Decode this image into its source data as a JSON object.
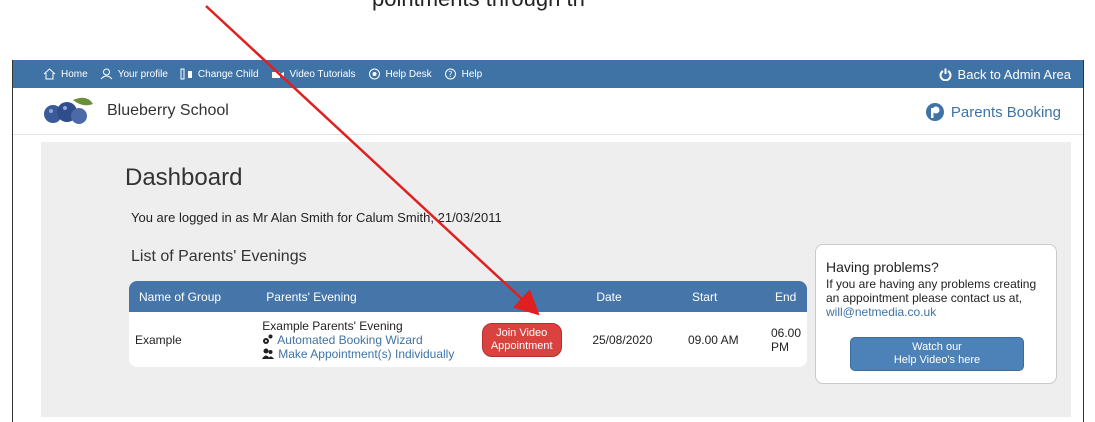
{
  "caption": {
    "text": "pointments through th"
  },
  "topbar": {
    "items": [
      {
        "label": "Home",
        "icon": "home-icon"
      },
      {
        "label": "Your profile",
        "icon": "user-icon"
      },
      {
        "label": "Change Child",
        "icon": "change-child-icon"
      },
      {
        "label": "Video Tutorials",
        "icon": "video-icon"
      },
      {
        "label": "Help Desk",
        "icon": "helpdesk-icon"
      },
      {
        "label": "Help",
        "icon": "help-icon"
      }
    ],
    "admin_label": "Back to Admin Area",
    "bg_color": "#3f73a6"
  },
  "header": {
    "school_name": "Blueberry School",
    "brand": "Parents Booking"
  },
  "dashboard": {
    "title": "Dashboard",
    "logged_in_text": "You are logged in as Mr Alan Smith for Calum Smith, 21/03/2011",
    "list_title": "List of Parents' Evenings"
  },
  "table": {
    "headers": [
      "Name of Group",
      "Parents' Evening",
      "",
      "Date",
      "Start",
      "End"
    ],
    "rows": [
      {
        "group": "Example",
        "evening": "Example Parents' Evening",
        "wizard_link": "Automated Booking Wizard",
        "individual_link": "Make Appointment(s) Individually",
        "join_label_line1": "Join Video",
        "join_label_line2": "Appointment",
        "date": "25/08/2020",
        "start": "09.00 AM",
        "end": "06.00 PM"
      }
    ]
  },
  "help": {
    "title": "Having problems?",
    "text": "If you are having any problems creating an appointment please contact us at, ",
    "email": "will@netmedia.co.uk",
    "button_line1": "Watch our",
    "button_line2": "Help Video's here"
  },
  "colors": {
    "accent": "#3f73a6",
    "join_button": "#d9423f",
    "arrow": "#e02020"
  }
}
